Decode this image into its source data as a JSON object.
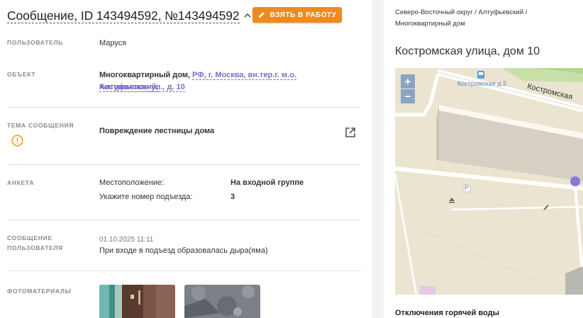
{
  "header": {
    "title": "Сообщение, ID 143494592, №143494592",
    "take_button_label": "ВЗЯТЬ В РАБОТУ"
  },
  "fields": {
    "user": {
      "label": "ПОЛЬЗОВАТЕЛЬ",
      "value": "Маруся"
    },
    "object": {
      "label": "ОБЪЕКТ",
      "prefix": "Многоквартирный дом,",
      "link_line1": "РФ, г. Москва, вн.тер.г. м.о. Алтуфьевский,",
      "link_line2": "Костромская ул., д. 10"
    },
    "topic": {
      "label": "ТЕМА СООБЩЕНИЯ",
      "value": "Повреждение лестницы дома"
    },
    "form": {
      "label": "АНКЕТА",
      "rows": [
        {
          "q": "Местоположение:",
          "a": "На входной группе"
        },
        {
          "q": "Укажите номер подъезда:",
          "a": "3"
        }
      ]
    },
    "message": {
      "label_line1": "СООБЩЕНИЕ",
      "label_line2": "ПОЛЬЗОВАТЕЛЯ",
      "date": "01.10.2025 11:11",
      "text": "При входе в подъезд образовалась дыра(яма)"
    },
    "photos": {
      "label": "ФОТОМАТЕРИАЛЫ"
    }
  },
  "sidebar": {
    "breadcrumb_line1": "Северо-Восточный округ / Алтуфьевский /",
    "breadcrumb_line2": "Многоквартирный дом",
    "address_title": "Костромская улица, дом 10",
    "map": {
      "zoom_in": "+",
      "zoom_out": "−",
      "stop_label": "Костромская д.3",
      "street_label": "Костромская",
      "parking_label": "P"
    },
    "hot_water_title": "Отключения горячей воды"
  },
  "colors": {
    "accent_orange": "#f08a1c",
    "link_purple": "#7b6fc4",
    "warning_orange": "#f0a030",
    "map_marker": "#8878d8"
  }
}
